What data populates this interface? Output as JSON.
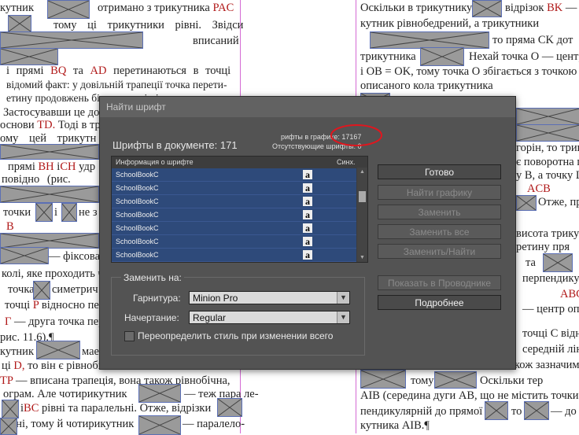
{
  "document": {
    "left_page_lines": [
      "",
      "",
      "",
      "",
      "",
      "",
      "",
      "",
      "",
      "",
      "",
      "",
      "",
      "",
      "",
      "",
      ""
    ],
    "right_page_lines": [
      "Оскільки в трикутнику",
      "кутник рівнобедрений, а трикутники",
      "то пряма CK дот",
      "трикутника",
      "Нехай точка O — центр",
      "і OB = OK, тому точка O збігається з точкою",
      "описаного кола трикутника",
      "горін, то трику",
      "є поворотна п",
      "у B, а точку L",
      "ACB",
      "Отже, пр",
      "висота трику",
      "ретину пря",
      "та",
      "перпендикул",
      "ABC",
      "— центр опис",
      "точці C відно",
      "середній лін",
      "кож зазначим",
      "тому",
      "Оскільки тер",
      "AIB (середина дуги AB, що не містить точки C",
      "пендикулярній до прямої",
      "то",
      "— до",
      "кутника AIB.¶"
    ],
    "left_visible_text": [
      "кутник",
      "отримано з трикутника",
      "PAC",
      "тому",
      "ці",
      "трикутники",
      "рівні.",
      "Звідси",
      "вписаний",
      "і прямі",
      "BQ",
      "та",
      "AD",
      "перетинаються",
      "в",
      "точці",
      "відомий факт: у довільній трапеції точка перети-",
      "етину продовжень бічних сторін і середини основ",
      "Застосувавши це до",
      "основи",
      "TD.",
      "Тоді в тр",
      "ому",
      "цей",
      "трикутн",
      "прямі",
      "BH",
      "і",
      "CH",
      "удр",
      "повідно",
      "(рис.",
      "точки",
      "і",
      "не з",
      "B",
      "— фіксова",
      "колі, яке проходить ч",
      "точка",
      "симетрич",
      "точці",
      "P",
      "відносно пер",
      "— друга точка пере",
      "рис. 11.6).¶",
      "кутник",
      "мае",
      "ці",
      "D,",
      "то він є рівнобі",
      "TP",
      "— вписана трапеція, вона також рівнобічна,",
      "ограм. Але чотирикутник",
      "— теж пара ле-",
      "і",
      "BC",
      "рівні та паралельні. Отже, відрізки",
      "ельні, тому й чотирикутник",
      "— паралело-"
    ]
  },
  "dialog": {
    "title": "Найти шрифт",
    "fonts_in_document": "Шрифты в документе: 171",
    "fonts_in_graphics": "рифты в графике: 17167",
    "missing_fonts": "Отсутствующие шрифты: 0",
    "table": {
      "col_info": "Информация о шрифте",
      "col_sync": "Синх.",
      "rows": [
        {
          "name": "SchoolBookC",
          "icon": "a"
        },
        {
          "name": "SchoolBookC",
          "icon": "a"
        },
        {
          "name": "SchoolBookC",
          "icon": "a"
        },
        {
          "name": "SchoolBookC",
          "icon": "a"
        },
        {
          "name": "SchoolBookC",
          "icon": "a"
        },
        {
          "name": "SchoolBookC",
          "icon": "a"
        },
        {
          "name": "SchoolBookC",
          "icon": "a"
        }
      ]
    },
    "buttons": {
      "done": "Готово",
      "find_graphic": "Найти графику",
      "replace": "Заменить",
      "replace_all": "Заменить все",
      "replace_find": "Заменить/Найти",
      "show_in_explorer": "Показать в Проводнике",
      "more": "Подробнее"
    },
    "replace_group": {
      "title": "Заменить на:",
      "family_label": "Гарнитура:",
      "family_value": "Minion Pro",
      "style_label": "Начертание:",
      "style_value": "Regular",
      "redefine_label": "Переопределить стиль при изменении всего",
      "redefine_checked": false
    },
    "annotation_color": "#e0161e"
  }
}
